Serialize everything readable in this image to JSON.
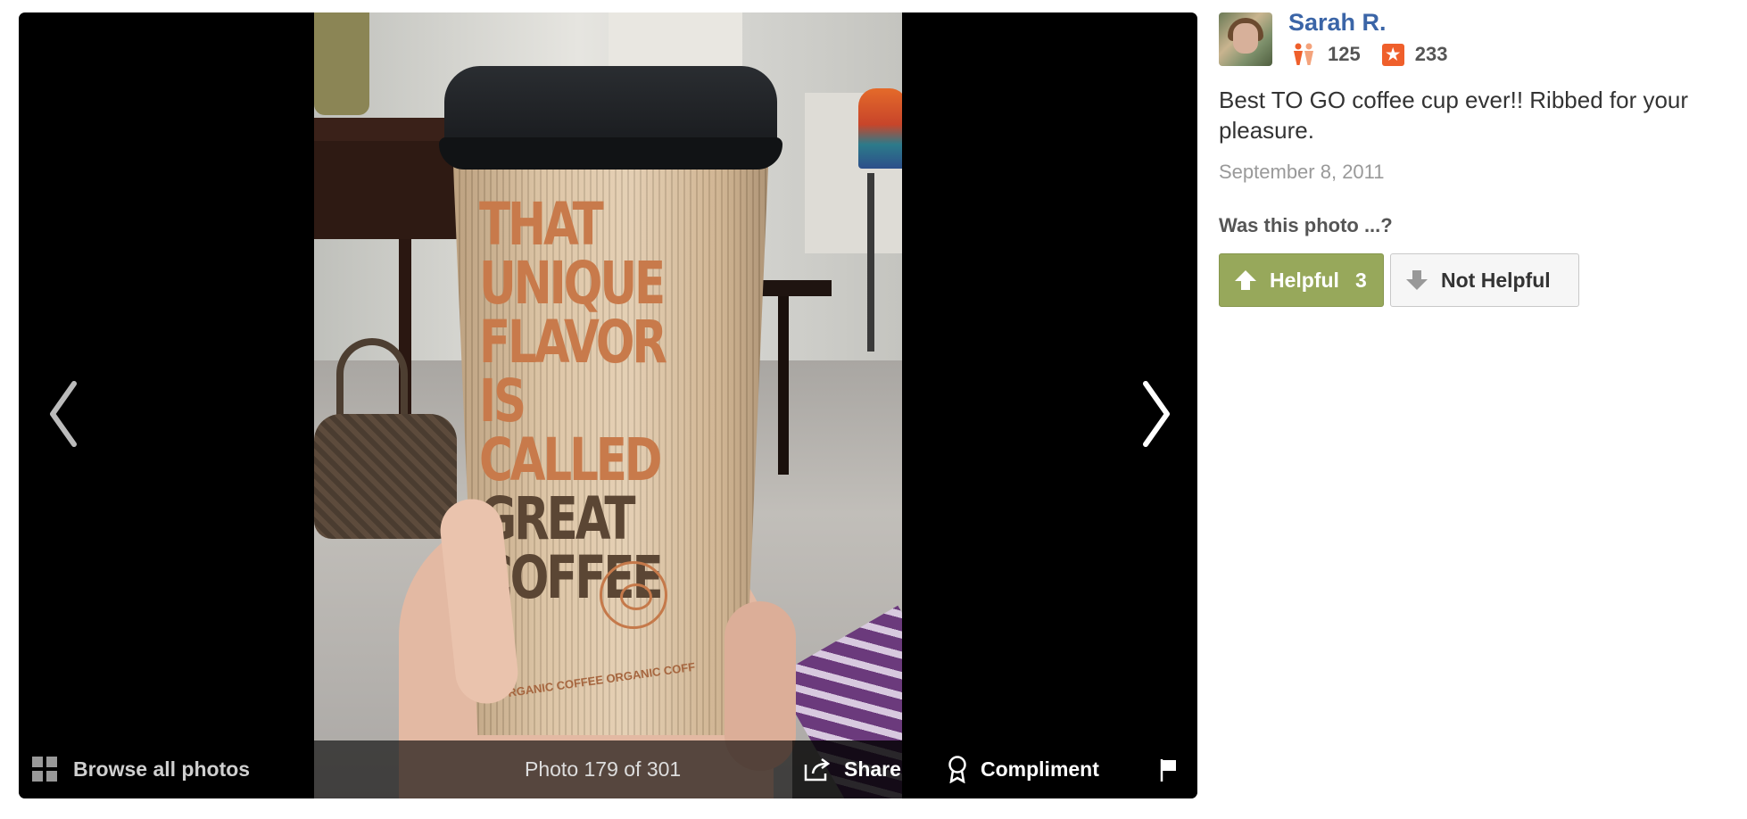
{
  "viewer": {
    "counter_text": "Photo 179 of 301",
    "browse_label": "Browse all photos",
    "share_label": "Share",
    "compliment_label": "Compliment",
    "cup_lines_orange": [
      "THAT",
      "UNIQUE",
      "FLAVOR",
      "IS CALLED"
    ],
    "cup_lines_brown": [
      "GREAT",
      "COFFEE"
    ],
    "cup_footer": "E ORGANIC COFFEE  ORGANIC COFF"
  },
  "sidebar": {
    "user_name": "Sarah R.",
    "friends_count": "125",
    "reviews_count": "233",
    "caption": "Best TO GO coffee cup ever!! Ribbed for your pleasure.",
    "date": "September 8, 2011",
    "question": "Was this photo ...?",
    "helpful_label": "Helpful",
    "helpful_count": "3",
    "not_helpful_label": "Not Helpful"
  },
  "colors": {
    "user_link": "#3b65a7",
    "helpful_green": "#97a85b",
    "review_star": "#ef5f2b"
  },
  "icons": [
    "chevron-left-icon",
    "chevron-right-icon",
    "grid-icon",
    "share-icon",
    "compliment-icon",
    "flag-icon",
    "friends-icon",
    "review-star-icon",
    "arrow-up-icon",
    "arrow-down-icon"
  ]
}
